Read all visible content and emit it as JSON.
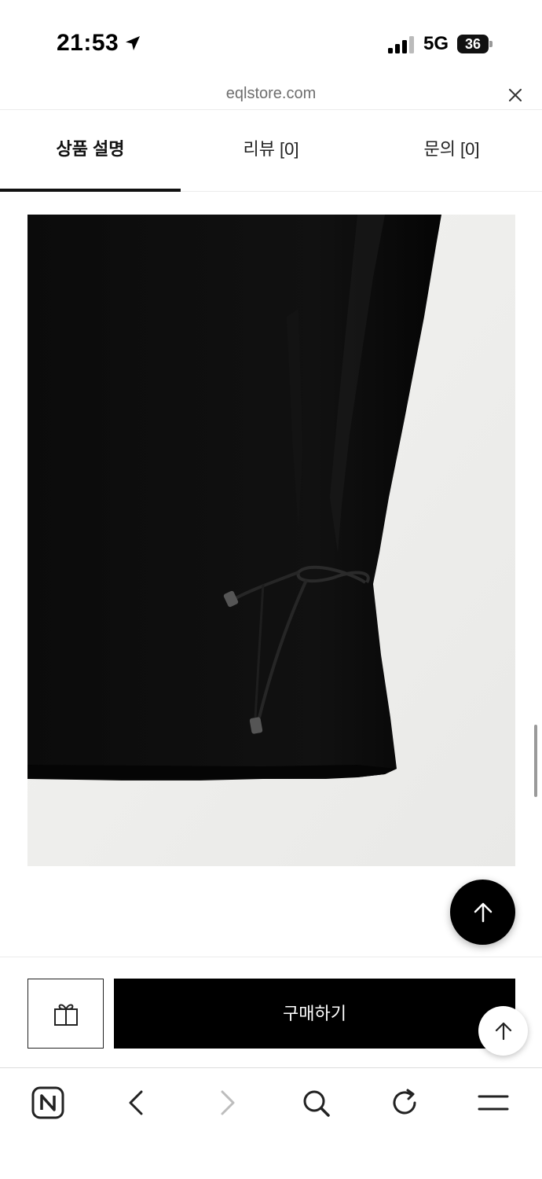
{
  "status_bar": {
    "time": "21:53",
    "network": "5G",
    "battery": "36"
  },
  "browser": {
    "url": "eqlstore.com"
  },
  "tabs": [
    {
      "label": "상품 설명",
      "active": true
    },
    {
      "label": "리뷰 [0]",
      "active": false
    },
    {
      "label": "문의 [0]",
      "active": false
    }
  ],
  "product": {
    "image_icon": "black-blouse-with-drawstring-photo"
  },
  "purchase": {
    "gift_icon": "gift-icon",
    "buy_label": "구매하기"
  },
  "toolbar_icons": [
    "naver-n-icon",
    "back-arrow-icon",
    "forward-arrow-icon",
    "search-icon",
    "refresh-icon",
    "menu-icon"
  ],
  "colors": {
    "primary": "#000000",
    "background": "#ffffff",
    "muted_text": "#6e6e6e"
  }
}
